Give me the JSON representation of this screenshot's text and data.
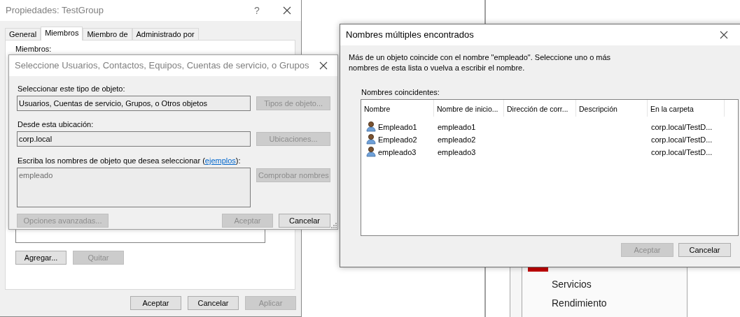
{
  "background": {
    "menu_items": [
      {
        "label": "Servicios"
      },
      {
        "label": "Rendimiento"
      }
    ]
  },
  "properties_window": {
    "title": "Propiedades: TestGroup",
    "help_button": "?",
    "tabs": [
      {
        "label": "General",
        "selected": false
      },
      {
        "label": "Miembros",
        "selected": true
      },
      {
        "label": "Miembro de",
        "selected": false
      },
      {
        "label": "Administrado por",
        "selected": false
      }
    ],
    "members_label": "Miembros:",
    "list_buttons": [
      {
        "label": "Agregar...",
        "disabled": false
      },
      {
        "label": "Quitar",
        "disabled": true
      }
    ],
    "buttons": [
      {
        "label": "Aceptar",
        "disabled": false
      },
      {
        "label": "Cancelar",
        "disabled": false
      },
      {
        "label": "Aplicar",
        "disabled": true
      }
    ]
  },
  "select_window": {
    "title": "Seleccione Usuarios, Contactos, Equipos, Cuentas de servicio, o Grupos",
    "object_type_label": "Seleccionar este tipo de objeto:",
    "object_type_value": "Usuarios, Cuentas de servicio, Grupos, o Otros objetos",
    "object_type_button": {
      "label": "Tipos de objeto...",
      "disabled": true
    },
    "location_label": "Desde esta ubicación:",
    "location_value": "corp.local",
    "location_button": {
      "label": "Ubicaciones...",
      "disabled": true
    },
    "names_label": "Escriba los nombres de objeto que desea seleccionar (",
    "names_link": "ejemplos",
    "names_label_end": "):",
    "names_value": "empleado",
    "check_button": {
      "label": "Comprobar nombres",
      "disabled": true
    },
    "advanced_button": {
      "label": "Opciones avanzadas...",
      "disabled": true
    },
    "buttons": [
      {
        "label": "Aceptar",
        "disabled": true
      },
      {
        "label": "Cancelar",
        "disabled": false
      }
    ]
  },
  "multiple_names_window": {
    "title": "Nombres múltiples encontrados",
    "message": "Más de un objeto coincide con el nombre \"empleado\". Seleccione uno o más nombres de esta lista o vuelva a escribir el nombre.",
    "list_label": "Nombres coincidentes:",
    "columns": [
      "Nombre",
      "Nombre de inicio...",
      "Dirección de corr...",
      "Descripción",
      "En la carpeta"
    ],
    "rows": [
      {
        "name": "Empleado1",
        "logon": "empleado1",
        "folder": "corp.local/TestD..."
      },
      {
        "name": "Empleado2",
        "logon": "empleado2",
        "folder": "corp.local/TestD..."
      },
      {
        "name": "empleado3",
        "logon": "empleado3",
        "folder": "corp.local/TestD..."
      }
    ],
    "buttons": [
      {
        "label": "Aceptar",
        "disabled": true
      },
      {
        "label": "Cancelar",
        "disabled": false
      }
    ]
  }
}
